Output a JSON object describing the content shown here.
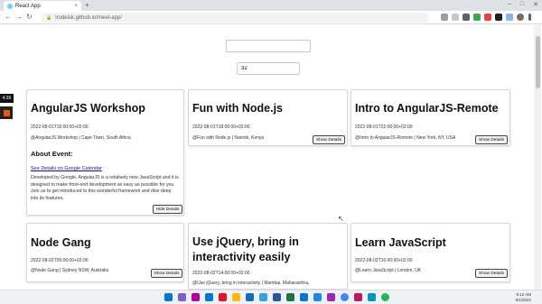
{
  "browser": {
    "tab_title": "React App",
    "tab_close": "×",
    "new_tab": "+",
    "window_controls": {
      "minimize": "–",
      "maximize": "□",
      "close": "✕"
    },
    "back": "←",
    "forward": "→",
    "reload": "↻",
    "url": "lrodeisk.github.io/meet-app/"
  },
  "app": {
    "search": {
      "value": "",
      "placeholder": ""
    },
    "number_of_events": {
      "value": "32"
    }
  },
  "side_widget": {
    "timer": "4:36"
  },
  "events": [
    {
      "title": "AngularJS Workshop",
      "datetime": "2022-08-01T16:00:00+02:00",
      "location": "@AngularJS Workshop | Cape Town, South Africa",
      "button": "Hide Details",
      "details": {
        "heading": "About Event:",
        "link": "See Details on Google Calendar",
        "description": "Developed by Google, AngularJS is a relatively new JavaScript and it is designed to make front-end development as easy as possible for you. Join us to get introduced to this wonderful framework and dive deep into its features."
      }
    },
    {
      "title": "Fun with Node.js",
      "datetime": "2022-08-01T18:00:00+02:00",
      "location": "@Fun with Node.js | Nairobi, Kenya",
      "button": "Show Details"
    },
    {
      "title": "Intro to AngularJS-Remote",
      "datetime": "2022-08-01T22:00:00+02:00",
      "location": "@Intro to AngularJS-Remote | New York, NY, USA",
      "button": "Show Details"
    },
    {
      "title": "Node Gang",
      "datetime": "2022-08-02T09:00:00+02:00",
      "location": "@Node Gang | Sydney NSW, Australia",
      "button": "Show Details"
    },
    {
      "title_line1": "Use jQuery, bring in",
      "title_line2": "interactivity easily",
      "datetime": "2022-08-02T14:00:00+02:00",
      "location": "@Use jQuery, bring in interactivity     | Mumbai, Maharashtra,"
    },
    {
      "title": "Learn JavaScript",
      "datetime": "2022-08-02T16:00:00+02:00",
      "location": "@Learn JavaScript | London, UK",
      "button": "Show Details"
    }
  ],
  "taskbar": {
    "time": "9:12 AM",
    "date": "8/1/2022"
  },
  "colors": {
    "accent_link": "#1a0dab",
    "record_button": "#e8590c",
    "tabbar_bg": "#dee1e6",
    "taskbar_bg": "#eef1f6"
  }
}
